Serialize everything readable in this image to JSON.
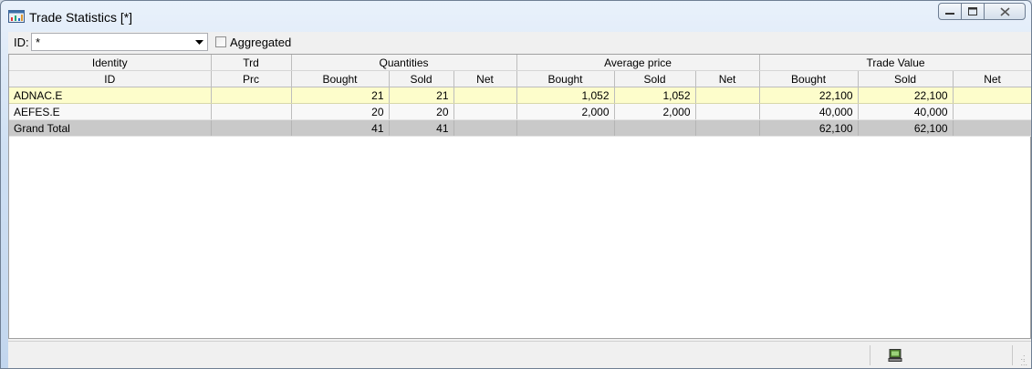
{
  "window": {
    "title": "Trade Statistics [*]"
  },
  "filter": {
    "id_label": "ID:",
    "id_value": "*",
    "aggregated_label": "Aggregated",
    "aggregated_checked": false
  },
  "table": {
    "group_headers": [
      "Identity",
      "Trd",
      "Quantities",
      "Average price",
      "Trade Value"
    ],
    "sub_headers": [
      "ID",
      "Prc",
      "Bought",
      "Sold",
      "Net",
      "Bought",
      "Sold",
      "Net",
      "Bought",
      "Sold",
      "Net"
    ],
    "rows": [
      [
        "ADNAC.E",
        "",
        "21",
        "21",
        "",
        "1,052",
        "1,052",
        "",
        "22,100",
        "22,100",
        ""
      ],
      [
        "AEFES.E",
        "",
        "20",
        "20",
        "",
        "2,000",
        "2,000",
        "",
        "40,000",
        "40,000",
        ""
      ]
    ],
    "total": [
      "Grand Total",
      "",
      "41",
      "41",
      "",
      "",
      "",
      "",
      "62,100",
      "62,100",
      ""
    ]
  },
  "colors": {
    "selected_row": "#fdfdcb",
    "total_row": "#c9c9c9",
    "header_bg": "#f3f3f3"
  },
  "icons": {
    "app": "trade-statistics-icon",
    "status": "monitor-icon"
  }
}
